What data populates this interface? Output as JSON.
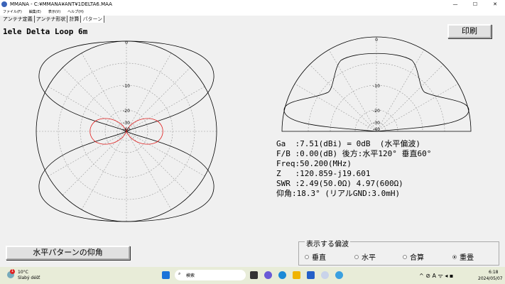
{
  "window": {
    "title": "MMANA - C:¥MMANA¥ANT¥1DELTA6.MAA",
    "minimize": "—",
    "maximize": "☐",
    "close": "✕"
  },
  "menu": [
    "ファイル(F)",
    "編集(E)",
    "表示(V)",
    "ヘルプ(H)"
  ],
  "tabs": [
    "アンテナ定義",
    "アンテナ形状",
    "計算",
    "パターン"
  ],
  "antenna_title": "1ele Delta Loop 6m",
  "print_button": "印刷",
  "elevation_button": "水平パターンの仰角",
  "ring_labels": [
    "0",
    "-10",
    "-20",
    "-30",
    "-40"
  ],
  "info": {
    "ga": "Ga  :7.51(dBi) = 0dB  (水平偏波)",
    "fb": "F/B :0.00(dB) 後方:水平120° 垂直60°",
    "freq": "Freq:50.200(MHz)",
    "z": "Z   :120.859-j19.601",
    "swr": "SWR :2.49(50.0Ω) 4.97(600Ω)",
    "elev": "仰角:18.3° (リアルGND:3.0mH)"
  },
  "polarization": {
    "label": "表示する偏波",
    "options": [
      "垂直",
      "水平",
      "合算",
      "重畳"
    ],
    "selected": "重畳"
  },
  "taskbar": {
    "temp": "10°C",
    "weather": "Slabý déšť",
    "badge": "1",
    "search": "検索",
    "time": "6:18",
    "date": "2024/05/07"
  },
  "colors": {
    "horizontal": "#000000",
    "vertical": "#e02020"
  }
}
